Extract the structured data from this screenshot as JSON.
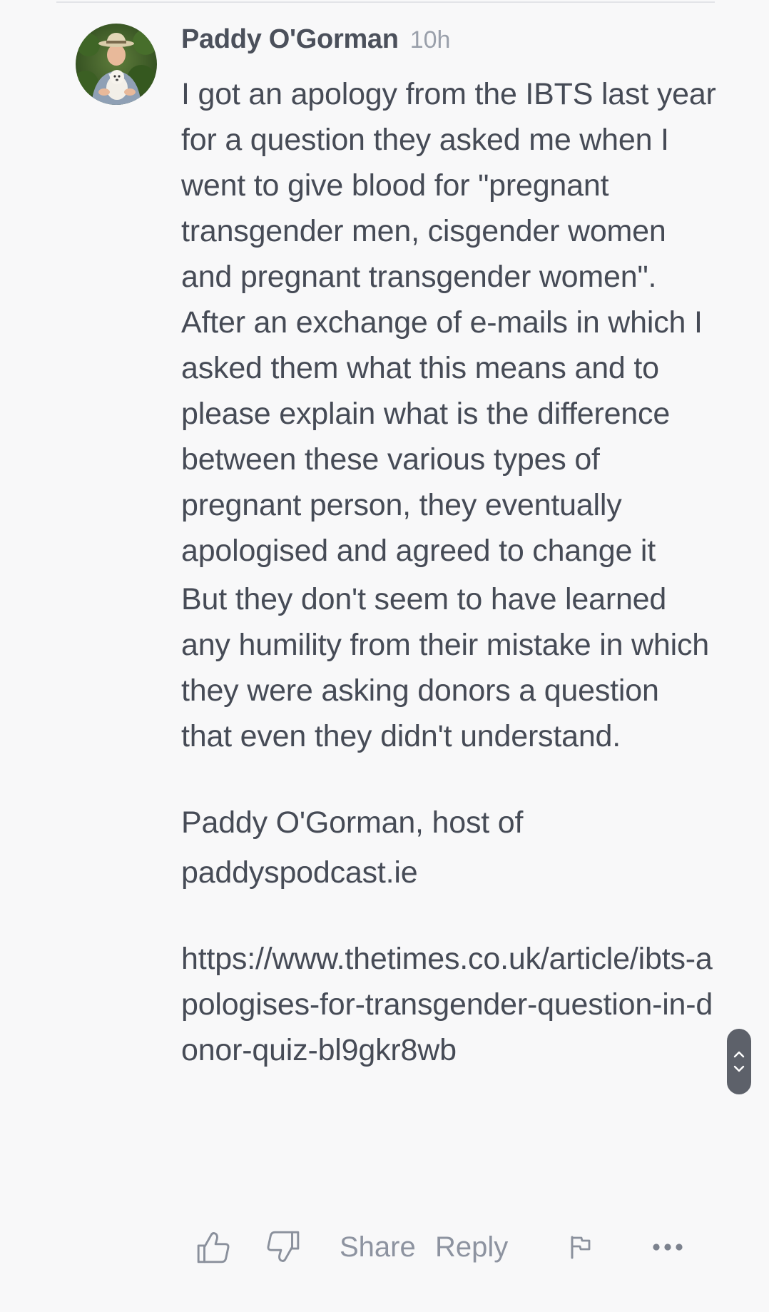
{
  "comment": {
    "author": "Paddy O'Gorman",
    "time": "10h",
    "paragraphs": [
      "I got an apology from the IBTS last year for a question they asked me when I went to give blood for \"pregnant transgender men, cisgender women and pregnant transgender women\". After an exchange of e-mails in which I asked them what this means and to please explain what is the difference between these various types of pregnant person, they eventually apologised and agreed to change it",
      "But they don't seem to have learned any humility from their mistake in which they were asking donors a question that even they didn't understand.",
      "Paddy O'Gorman, host of paddyspodcast.ie",
      "https://www.thetimes.co.uk/article/ibts-apologises-for-transgender-question-in-donor-quiz-bl9gkr8wb"
    ]
  },
  "actions": {
    "like_icon": "thumbs-up-icon",
    "dislike_icon": "thumbs-down-icon",
    "share_label": "Share",
    "reply_label": "Reply",
    "flag_icon": "flag-icon",
    "more_icon": "more-icon"
  },
  "scroll": {
    "up_icon": "chevron-up-icon",
    "down_icon": "chevron-down-icon"
  },
  "colors": {
    "background": "#f8f8f9",
    "text": "#464b56",
    "muted": "#8d93a0",
    "scroll_handle": "#5d616a"
  }
}
